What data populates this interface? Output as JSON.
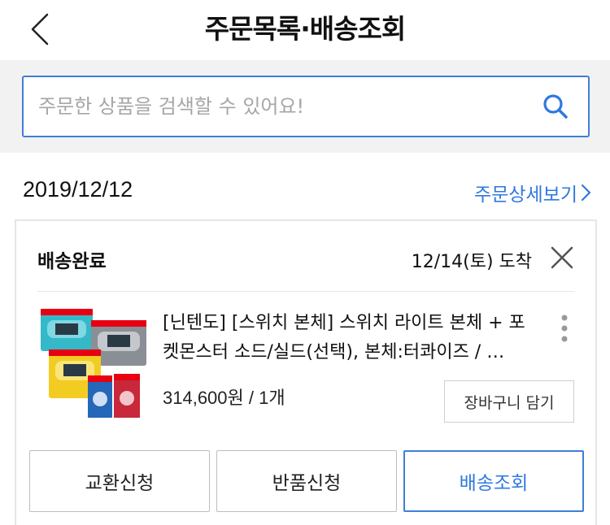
{
  "header": {
    "title": "주문목록·배송조회"
  },
  "search": {
    "placeholder": "주문한 상품을 검색할 수 있어요!"
  },
  "order": {
    "date": "2019/12/12",
    "detail_link": "주문상세보기",
    "status": "배송완료",
    "arrival": "12/14(토) 도착",
    "product": {
      "name_line1": "[닌텐도] [스위치 본체] 스위치 라이트 본체 + 포",
      "name_line2": "켓몬스터 소드/실드(선택), 본체:터콰이즈 / …",
      "price": "314,600원 / 1개",
      "cart_button": "장바구니 담기"
    },
    "actions": {
      "exchange": "교환신청",
      "return": "반품신청",
      "tracking": "배송조회"
    }
  },
  "colors": {
    "accent": "#3f7fd8",
    "link": "#2f78e0"
  },
  "icons": [
    "back-arrow-icon",
    "search-icon",
    "chevron-right-icon",
    "close-icon",
    "more-vertical-icon"
  ]
}
